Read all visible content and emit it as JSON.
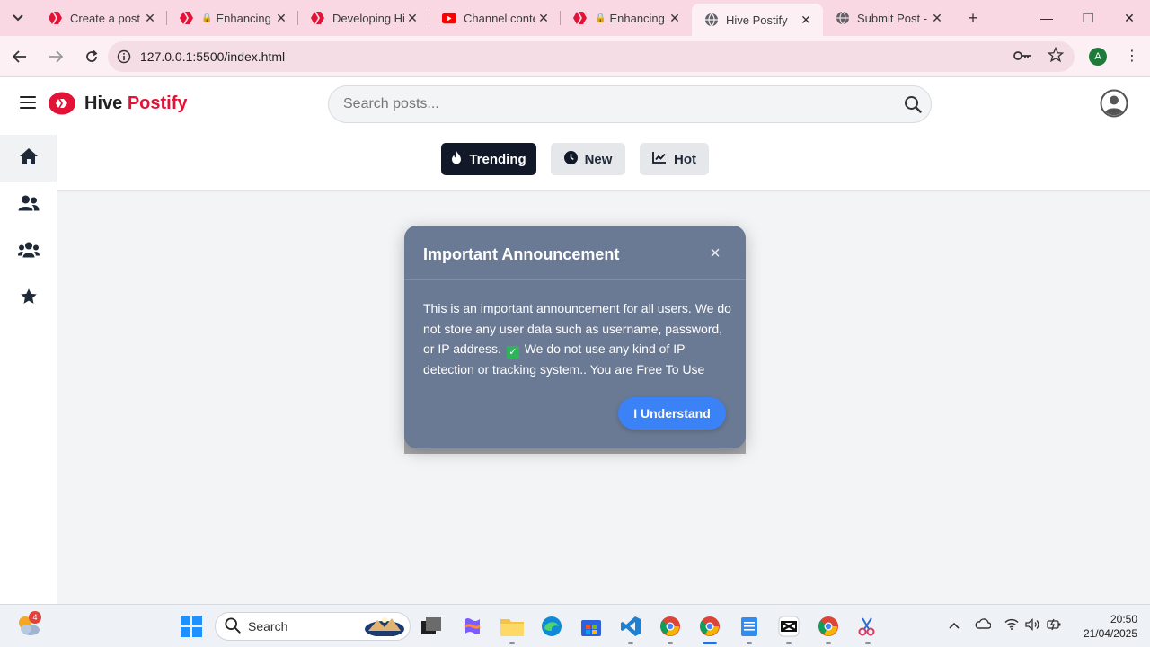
{
  "browser": {
    "tabs": [
      {
        "title": "Create a post",
        "icon": "hive-icon"
      },
      {
        "title": "Enhancing",
        "icon": "hive-icon"
      },
      {
        "title": "Developing Hi",
        "icon": "hive-icon"
      },
      {
        "title": "Channel conte",
        "icon": "youtube-icon"
      },
      {
        "title": "Enhancing",
        "icon": "hive-icon"
      },
      {
        "title": "Hive Postify",
        "icon": "globe-icon"
      },
      {
        "title": "Submit Post -",
        "icon": "globe-icon"
      }
    ],
    "url": "127.0.0.1:5500/index.html",
    "profile_initial": "A"
  },
  "header": {
    "brand_part1": "Hive",
    "brand_part2": "Postify",
    "search_placeholder": "Search posts..."
  },
  "sidebar": {
    "items": [
      {
        "name": "home-icon"
      },
      {
        "name": "users-icon"
      },
      {
        "name": "group-icon"
      },
      {
        "name": "star-icon"
      }
    ]
  },
  "filters": {
    "trending": "Trending",
    "new": "New",
    "hot": "Hot"
  },
  "modal": {
    "title": "Important Announcement",
    "close": "×",
    "body_part1": "This is an important announcement for all users. We do not store any user data such as username, password, or IP address.",
    "body_part2": "We do not use any kind of IP detection or tracking system.. You are Free To Use",
    "button": "I Understand"
  },
  "taskbar": {
    "search_label": "Search",
    "notification_count": "4",
    "time": "20:50",
    "date": "21/04/2025"
  },
  "colors": {
    "brand_red": "#e31337",
    "modal_bg": "#6b7a94",
    "primary_button": "#3b82f6",
    "trending_bg": "#111827"
  }
}
